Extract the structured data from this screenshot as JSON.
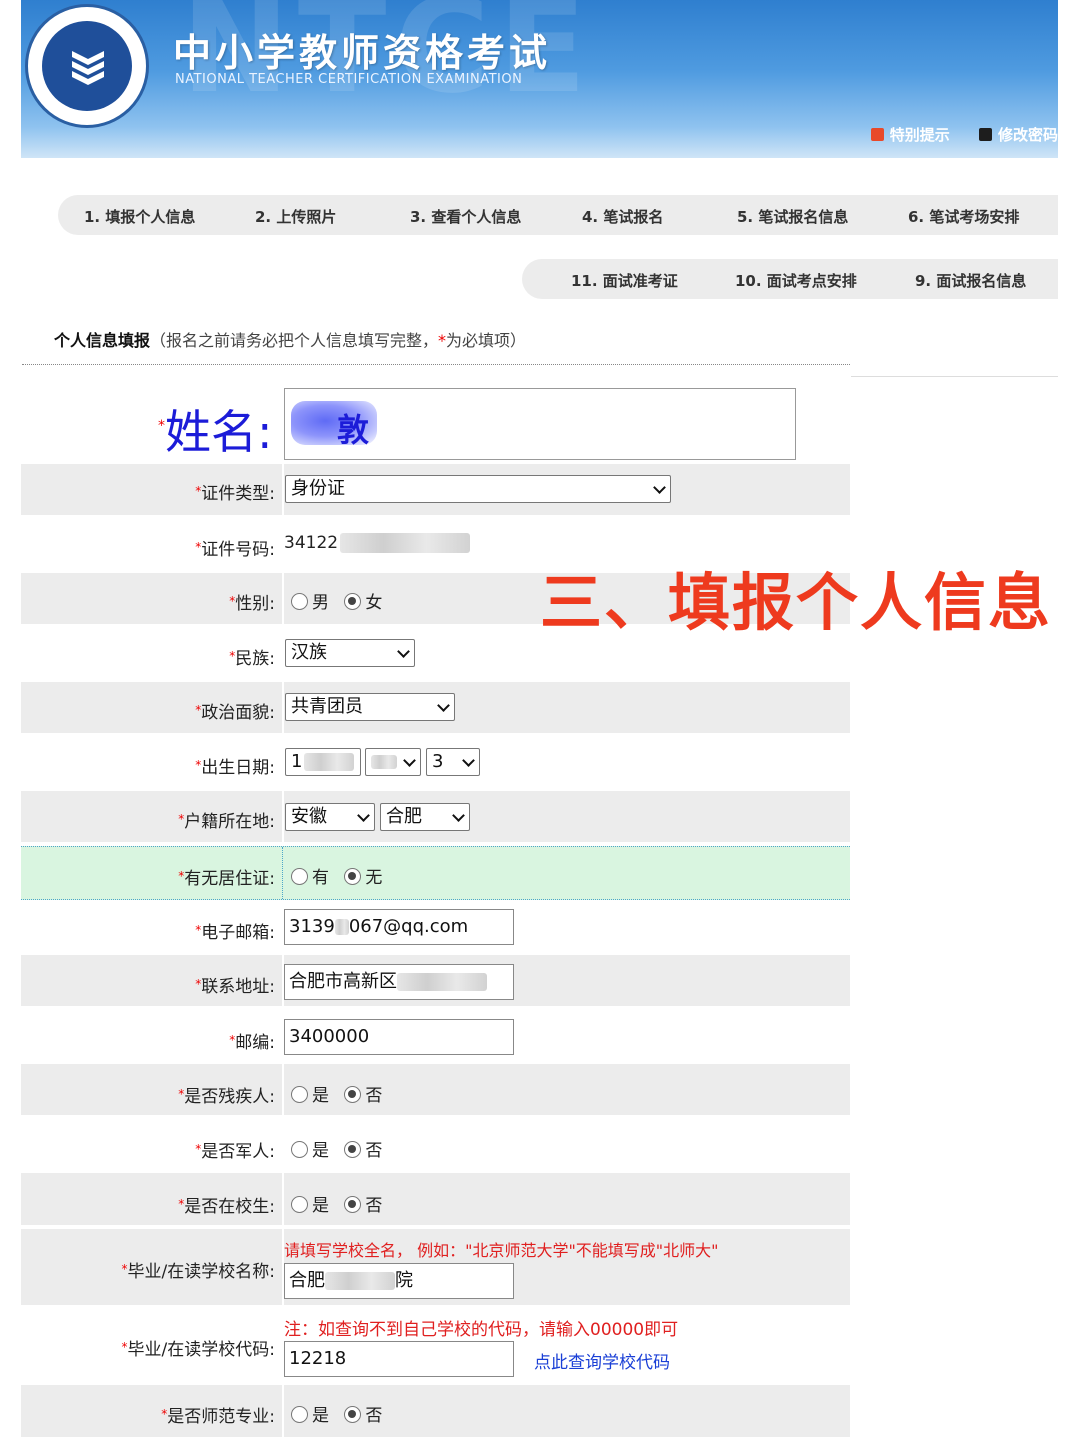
{
  "header": {
    "title": "中小学教师资格考试",
    "subtitle": "NATIONAL TEACHER CERTIFICATION EXAMINATION",
    "watermark": "NTCE",
    "links": [
      {
        "label": "特别提示",
        "icon": "notice-icon",
        "color": "#e8492a"
      },
      {
        "label": "修改密码",
        "icon": "key-icon",
        "color": "#1d1d1d"
      }
    ]
  },
  "steps_row1": [
    "1. 填报个人信息",
    "2. 上传照片",
    "3. 查看个人信息",
    "4. 笔试报名",
    "5. 笔试报名信息",
    "6. 笔试考场安排"
  ],
  "steps_row2": [
    "11. 面试准考证",
    "10. 面试考点安排",
    "9. 面试报名信息"
  ],
  "section": {
    "title": "个人信息填报",
    "hint_prefix": "（报名之前请务必把个人信息填写完整，",
    "hint_star": "*",
    "hint_suffix": "为必填项）"
  },
  "overlay_title": "三、填报个人信息",
  "form": {
    "name_label": "姓名:",
    "name_value_partial": "敦",
    "id_type_label": "证件类型:",
    "id_type_value": "身份证",
    "id_number_label": "证件号码:",
    "id_number_value": "34122",
    "gender_label": "性别:",
    "gender_options": [
      "男",
      "女"
    ],
    "gender_selected": "女",
    "ethnicity_label": "民族:",
    "ethnicity_value": "汉族",
    "political_label": "政治面貌:",
    "political_value": "共青团员",
    "birth_label": "出生日期:",
    "birth_year_partial": "1",
    "birth_day": "3",
    "hukou_label": "户籍所在地:",
    "hukou_province": "安徽",
    "hukou_city": "合肥",
    "residence_label": "有无居住证:",
    "residence_options": [
      "有",
      "无"
    ],
    "residence_selected": "无",
    "email_label": "电子邮箱:",
    "email_prefix": "3139",
    "email_suffix": "067@qq.com",
    "address_label": "联系地址:",
    "address_value": "合肥市高新区",
    "postcode_label": "邮编:",
    "postcode_value": "3400000",
    "disabled_label": "是否残疾人:",
    "yes_no_options": [
      "是",
      "否"
    ],
    "disabled_selected": "否",
    "military_label": "是否军人:",
    "military_selected": "否",
    "student_label": "是否在校生:",
    "student_selected": "否",
    "school_label": "毕业/在读学校名称:",
    "school_note": "请填写学校全名，  例如：\"北京师范大学\"不能填写成\"北师大\"",
    "school_value_prefix": "合肥",
    "school_value_suffix": "院",
    "school_code_label": "毕业/在读学校代码:",
    "school_code_note": "注：如查询不到自己学校的代码，请输入00000即可",
    "school_code_value": "12218",
    "school_code_link": "点此查询学校代码",
    "normal_major_label": "是否师范专业:",
    "normal_major_selected": "否"
  }
}
